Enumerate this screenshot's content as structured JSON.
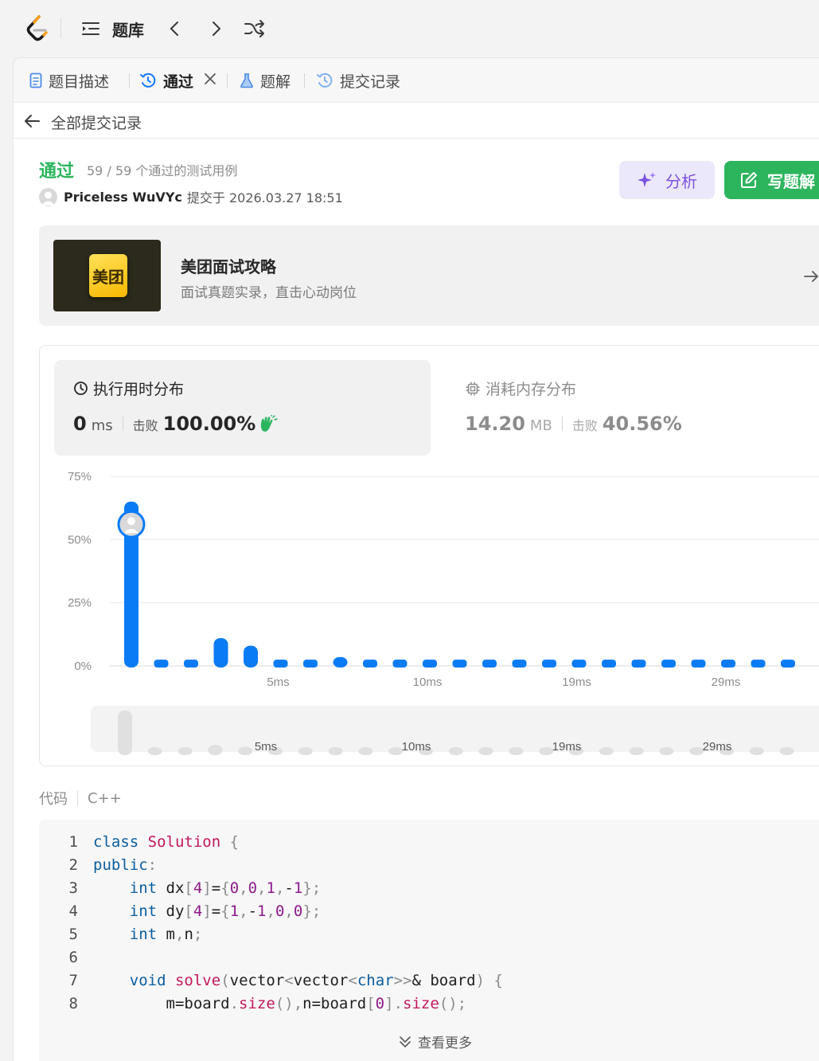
{
  "nav": {
    "title": "题库"
  },
  "tabs": {
    "description": "题目描述",
    "accepted": "通过",
    "solutions": "题解",
    "submissions": "提交记录"
  },
  "back_label": "全部提交记录",
  "result": {
    "status": "通过",
    "testcases": "59 / 59 个通过的测试用例",
    "author": "Priceless WuVYc",
    "submitted": "提交于 2026.03.27 18:51"
  },
  "buttons": {
    "analyze": "分析",
    "write_solution": "写题解"
  },
  "promo": {
    "logo_text": "美团",
    "title": "美团面试攻略",
    "subtitle": "面试真题实录，直击心动岗位"
  },
  "runtime": {
    "title": "执行用时分布",
    "value": "0",
    "unit": "ms",
    "beats_label": "击败",
    "beats": "100.00%"
  },
  "memory": {
    "title": "消耗内存分布",
    "value": "14.20",
    "unit": "MB",
    "beats_label": "击败",
    "beats": "40.56%"
  },
  "colors": {
    "accepted": "#2db55d",
    "bar": "#0a7bf5",
    "analyze": "#7a52e0"
  },
  "chart_data": {
    "type": "bar",
    "xlabel": "",
    "ylabel": "",
    "ylim": [
      0,
      75
    ],
    "y_ticks": [
      "75%",
      "50%",
      "25%",
      "0%"
    ],
    "x_tick_labels": [
      "5ms",
      "10ms",
      "19ms",
      "29ms"
    ],
    "x_tick_bar_index": [
      5,
      10,
      15,
      20
    ],
    "values": [
      65,
      2.5,
      2.5,
      11,
      8,
      2.5,
      2.5,
      3.5,
      2.5,
      2.5,
      2.5,
      2.5,
      2.5,
      2.5,
      2.5,
      2.5,
      2.5,
      2.5,
      2.5,
      2.5,
      2.5,
      2.5,
      2.5
    ],
    "highlight_index": 0,
    "highlight_value": 56,
    "grid": true
  },
  "code": {
    "label": "代码",
    "language": "C++",
    "more": "查看更多",
    "line_numbers": [
      "1",
      "2",
      "3",
      "4",
      "5",
      "6",
      "7",
      "8"
    ]
  }
}
